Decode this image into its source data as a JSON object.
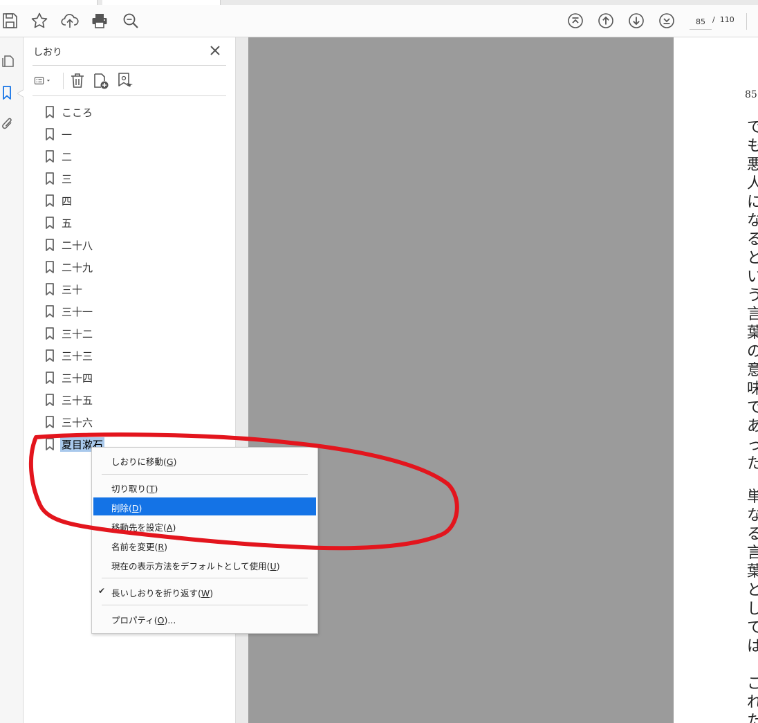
{
  "toolbar": {
    "icons": [
      "save-icon",
      "star-icon",
      "cloud-upload-icon",
      "print-icon",
      "zoom-icon",
      "first-page-icon",
      "prev-page-icon",
      "next-page-icon",
      "last-page-icon"
    ],
    "current_page": "85",
    "page_total": "/  110"
  },
  "rail": {
    "icons": [
      "page-thumbnails-icon",
      "bookmark-icon",
      "attachment-icon"
    ]
  },
  "panel": {
    "title": "しおり",
    "tools": [
      "options-menu-icon",
      "delete-icon",
      "new-bookmark-icon",
      "bookmark-from-selection-icon"
    ],
    "bookmarks": [
      {
        "label": "こころ"
      },
      {
        "label": "一"
      },
      {
        "label": "二"
      },
      {
        "label": "三"
      },
      {
        "label": "四"
      },
      {
        "label": "五"
      },
      {
        "label": "二十八"
      },
      {
        "label": "二十九"
      },
      {
        "label": "三十"
      },
      {
        "label": "三十一"
      },
      {
        "label": "三十二"
      },
      {
        "label": "三十三"
      },
      {
        "label": "三十四"
      },
      {
        "label": "三十五"
      },
      {
        "label": "三十六"
      },
      {
        "label": "夏目漱石",
        "selected": true
      }
    ]
  },
  "document": {
    "page_number": "85",
    "columns": [
      "でも悪人になるという言葉の意味であった。",
      "単なる言葉としては",
      "これた"
    ]
  },
  "context_menu": {
    "items": [
      {
        "text": "しおりに移動",
        "accel": "G"
      },
      {
        "text": "切り取り",
        "accel": "T"
      },
      {
        "text": "削除",
        "accel": "D",
        "active": true
      },
      {
        "text": "移動先を設定",
        "accel": "A"
      },
      {
        "text": "名前を変更",
        "accel": "R"
      },
      {
        "text": "現在の表示方法をデフォルトとして使用",
        "accel": "U"
      },
      {
        "text": "長いしおりを折り返す",
        "accel": "W",
        "checked": true
      },
      {
        "text": "プロパティ",
        "accel": "O",
        "suffix": "..."
      }
    ]
  },
  "colors": {
    "accent": "#1473e6",
    "selection": "#a9c9ec",
    "annotation": "#e3151d",
    "doc_background": "#9b9b9b"
  }
}
